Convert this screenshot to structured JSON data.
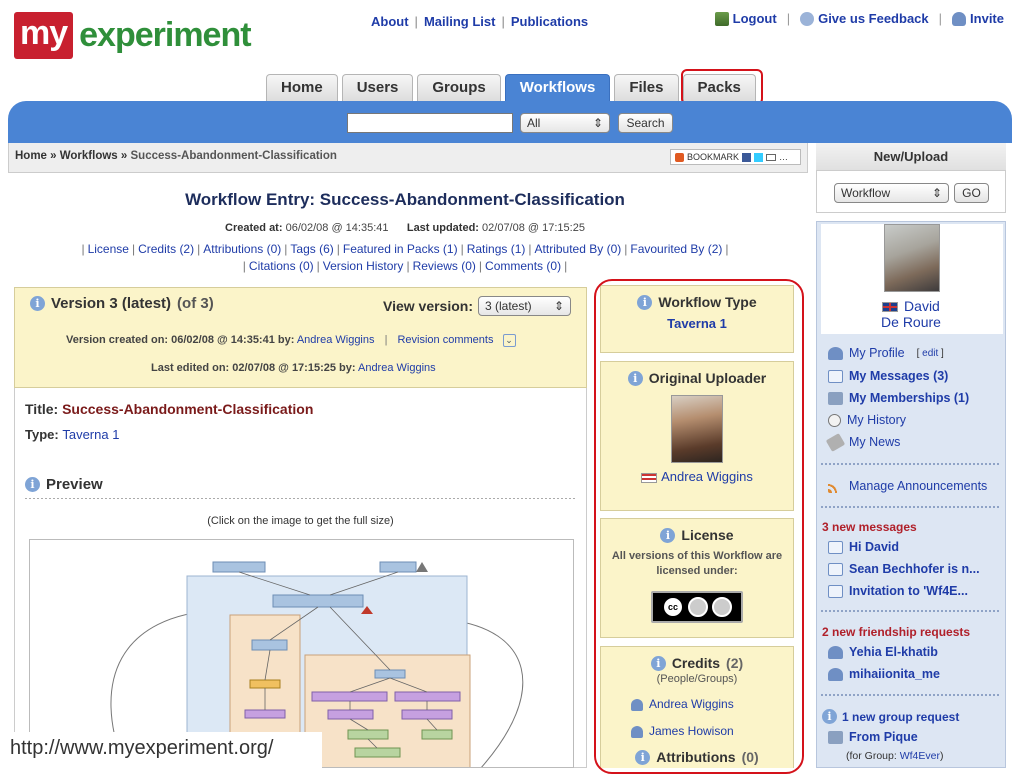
{
  "logo": {
    "part1": "my",
    "part2": "experiment"
  },
  "top_links": [
    "About",
    "Mailing List",
    "Publications"
  ],
  "user_links": {
    "logout": "Logout",
    "feedback": "Give us Feedback",
    "invite": "Invite"
  },
  "tabs": [
    {
      "label": "Home",
      "active": false
    },
    {
      "label": "Users",
      "active": false
    },
    {
      "label": "Groups",
      "active": false
    },
    {
      "label": "Workflows",
      "active": true
    },
    {
      "label": "Files",
      "active": false
    },
    {
      "label": "Packs",
      "active": false
    }
  ],
  "search": {
    "value": "",
    "scope": "All",
    "button": "Search"
  },
  "breadcrumb": {
    "home": "Home",
    "section": "Workflows",
    "current": "Success-Abandonment-Classification",
    "sep": "»"
  },
  "bookmark_label": "BOOKMARK",
  "workflow": {
    "heading": "Workflow Entry: Success-Abandonment-Classification",
    "created_label": "Created at:",
    "created": "06/02/08 @ 14:35:41",
    "updated_label": "Last updated:",
    "updated": "02/07/08 @ 17:15:25",
    "links1": [
      "License",
      "Credits (2)",
      "Attributions (0)",
      "Tags (6)",
      "Featured in Packs (1)",
      "Ratings (1)",
      "Attributed By (0)",
      "Favourited By (2)"
    ],
    "links2": [
      "Citations (0)",
      "Version History",
      "Reviews (0)",
      "Comments (0)"
    ]
  },
  "version": {
    "title": "Version 3 (latest)",
    "of": "(of 3)",
    "view_label": "View version:",
    "view_value": "3 (latest)",
    "created_text": "Version created on: 06/02/08 @ 14:35:41 by:",
    "created_by": "Andrea Wiggins",
    "revision_comments": "Revision comments",
    "edited_text": "Last edited on: 02/07/08 @ 17:15:25 by:",
    "edited_by": "Andrea Wiggins"
  },
  "details": {
    "title_label": "Title:",
    "title_value": "Success-Abandonment-Classification",
    "type_label": "Type:",
    "type_value": "Taverna 1",
    "preview_heading": "Preview",
    "preview_hint": "(Click on the image to get the full size)"
  },
  "sidebar_mid": {
    "workflow_type_head": "Workflow Type",
    "workflow_type_value": "Taverna 1",
    "uploader_head": "Original Uploader",
    "uploader_name": "Andrea Wiggins",
    "license_head": "License",
    "license_text": "All versions of this Workflow are licensed under:",
    "credits_head": "Credits",
    "credits_count": "(2)",
    "credits_sub": "(People/Groups)",
    "credits": [
      "Andrea Wiggins",
      "James Howison"
    ],
    "attributions_head": "Attributions",
    "attributions_count": "(0)"
  },
  "new_upload": {
    "head": "New/Upload",
    "select": "Workflow",
    "go": "GO"
  },
  "profile": {
    "name_line1": "David",
    "name_line2": "De Roure",
    "menu": [
      {
        "label": "My Profile",
        "bold": false,
        "extra": "edit"
      },
      {
        "label": "My Messages (3)",
        "bold": true
      },
      {
        "label": "My Memberships (1)",
        "bold": true
      },
      {
        "label": "My History",
        "bold": false
      },
      {
        "label": "My News",
        "bold": false
      }
    ],
    "manage": "Manage Announcements",
    "messages_head": "3 new messages",
    "messages": [
      "Hi David",
      "Sean Bechhofer is n...",
      "Invitation to 'Wf4E..."
    ],
    "friend_head": "2 new friendship requests",
    "friends": [
      "Yehia El-khatib",
      "mihaiionita_me"
    ],
    "group_head": "1 new group request",
    "group_from": "From Pique",
    "group_for_label": "(for Group:",
    "group_for": "Wf4Ever",
    "group_for_end": ")"
  },
  "url": "http://www.myexperiment.org/",
  "colors": {
    "tab_active": "#4a84d4",
    "highlight": "#d4121a",
    "brand_red": "#c8202f",
    "brand_green": "#2f8f3a"
  }
}
